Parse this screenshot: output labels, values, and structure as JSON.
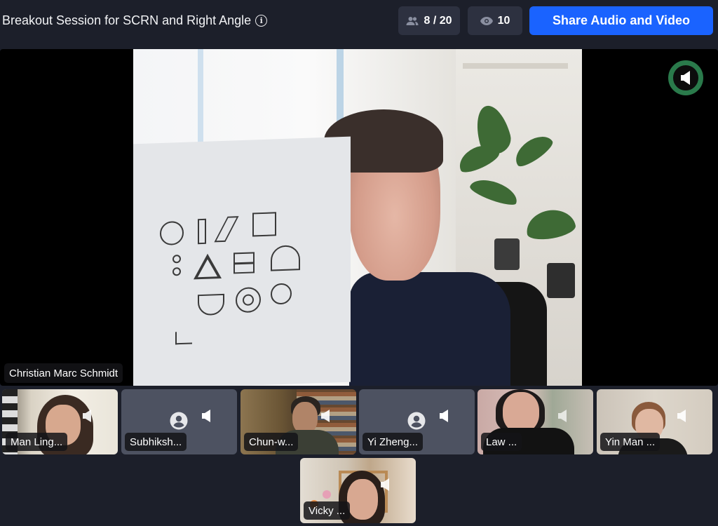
{
  "header": {
    "title": "Breakout Session for SCRN and Right Angle",
    "info_icon": "info-icon",
    "participants": {
      "icon": "people-icon",
      "label": "8 / 20"
    },
    "viewers": {
      "icon": "eye-icon",
      "label": "10"
    },
    "share_button": "Share Audio and Video"
  },
  "main_video": {
    "speaker_name": "Christian Marc Schmidt",
    "speaking_indicator": "speaker-icon",
    "colors": {
      "indicator_ring": "#2a7a4b"
    }
  },
  "participants": [
    {
      "name": "Man Ling...",
      "video": true
    },
    {
      "name": "Subhiksh...",
      "video": false
    },
    {
      "name": "Chun-w...",
      "video": true
    },
    {
      "name": "Yi Zheng...",
      "video": false
    },
    {
      "name": "Law ...",
      "video": true
    },
    {
      "name": "Yin Man ...",
      "video": true
    },
    {
      "name": "Vicky ...",
      "video": true
    }
  ],
  "colors": {
    "background": "#1c1f2a",
    "pill": "#2d3140",
    "accent": "#1a63ff",
    "avatar_tile": "#4d5261"
  }
}
